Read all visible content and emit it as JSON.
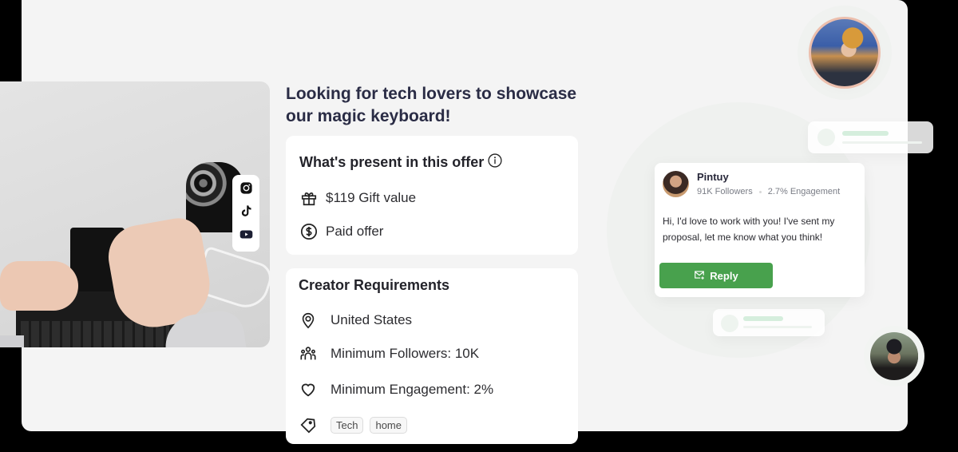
{
  "social_icons": [
    "instagram-icon",
    "tiktok-icon",
    "youtube-icon"
  ],
  "headline": "Looking for tech lovers to showcase our magic keyboard!",
  "offer": {
    "title": "What's present in this offer",
    "items": [
      {
        "icon": "gift-icon",
        "label": "$119 Gift value"
      },
      {
        "icon": "dollar-circle-icon",
        "label": "Paid offer"
      }
    ]
  },
  "requirements": {
    "title": "Creator Requirements",
    "items": [
      {
        "icon": "location-pin-icon",
        "label": "United States"
      },
      {
        "icon": "users-icon",
        "label": "Minimum Followers: 10K"
      },
      {
        "icon": "heart-icon",
        "label": "Minimum Engagement: 2%"
      }
    ],
    "tags": [
      "Tech",
      "home"
    ]
  },
  "message": {
    "name": "Pintuy",
    "followers": "91K Followers",
    "engagement": "2.7% Engagement",
    "text": "Hi, I'd love to work with you! I've sent my proposal, let me know what you think!",
    "reply_label": "Reply"
  },
  "colors": {
    "accent_green": "#48a14d",
    "headline": "#2a2c45",
    "panel_bg": "#f4f4f4"
  }
}
